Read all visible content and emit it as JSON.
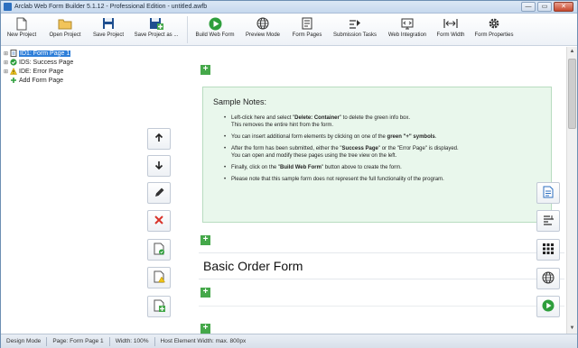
{
  "window": {
    "title": "Arclab Web Form Builder 5.1.12 - Professional Edition - untitled.awfb",
    "controls": {
      "minimize": "—",
      "maximize": "▭",
      "close": "✕"
    }
  },
  "toolbar": {
    "items": [
      {
        "label": "New Project",
        "icon": "new-document-icon"
      },
      {
        "label": "Open Project",
        "icon": "folder-icon"
      },
      {
        "label": "Save Project",
        "icon": "save-icon"
      },
      {
        "label": "Save Project as ...",
        "icon": "save-as-icon"
      },
      {
        "label": "Build Web Form",
        "icon": "play-icon"
      },
      {
        "label": "Preview Mode",
        "icon": "globe-icon"
      },
      {
        "label": "Form Pages",
        "icon": "pages-icon"
      },
      {
        "label": "Submission Tasks",
        "icon": "tasks-icon"
      },
      {
        "label": "Web Integration",
        "icon": "web-integration-icon"
      },
      {
        "label": "Form Width",
        "icon": "width-icon"
      },
      {
        "label": "Form Properties",
        "icon": "gear-icon"
      }
    ]
  },
  "tree": {
    "items": [
      {
        "label": "ID1: Form Page 1",
        "selected": true,
        "icon": "page-icon",
        "expander": "⊞"
      },
      {
        "label": "IDS: Success Page",
        "selected": false,
        "icon": "success-icon",
        "expander": "⊞"
      },
      {
        "label": "IDE: Error Page",
        "selected": false,
        "icon": "warning-icon",
        "expander": "⊞"
      },
      {
        "label": "Add Form Page",
        "selected": false,
        "icon": "add-icon",
        "expander": ""
      }
    ]
  },
  "side_tools": [
    {
      "name": "move-up",
      "icon": "arrow-up-icon"
    },
    {
      "name": "move-down",
      "icon": "arrow-down-icon"
    },
    {
      "name": "edit",
      "icon": "pencil-icon"
    },
    {
      "name": "delete",
      "icon": "delete-icon"
    },
    {
      "name": "success-page",
      "icon": "success-page-icon"
    },
    {
      "name": "error-page",
      "icon": "error-page-icon"
    },
    {
      "name": "add-page",
      "icon": "add-page-icon"
    }
  ],
  "notes": {
    "title": "Sample Notes:",
    "bullets": [
      [
        "Left-click here and select \"",
        "Delete: Container",
        "\" to delete the green info box.",
        "This removes the entire hint from the form."
      ],
      [
        "You can insert additional form elements by clicking on one of the ",
        "green \"+\" symbols",
        ".",
        ""
      ],
      [
        "After the form has been submitted, either the \"",
        "Success Page",
        "\" or the \"Error Page\" is displayed.",
        "You can open and modify these pages using the tree view on the left."
      ],
      [
        "Finally, click on the \"",
        "Build Web Form",
        "\" button above to create the form.",
        ""
      ],
      [
        "Please note that this sample form does not represent the full functionality of the program.",
        "",
        "",
        ""
      ]
    ]
  },
  "form": {
    "title": "Basic Order Form",
    "plus_symbol": "+"
  },
  "right_tools": [
    {
      "name": "page-properties",
      "icon": "document-icon"
    },
    {
      "name": "align",
      "icon": "align-icon"
    },
    {
      "name": "grid",
      "icon": "grid-icon"
    },
    {
      "name": "web",
      "icon": "globe-icon"
    },
    {
      "name": "run",
      "icon": "play-icon"
    }
  ],
  "scrollbar": {
    "up": "▲",
    "down": "▼"
  },
  "status": {
    "items": [
      "Design Mode",
      "Page: Form Page 1",
      "Width: 100%",
      "Host Element Width: max. 800px"
    ]
  },
  "colors": {
    "accent_green": "#45a84a",
    "notes_bg": "#e9f7ec",
    "selection_blue": "#2f7fd9",
    "delete_red": "#d9342b"
  }
}
